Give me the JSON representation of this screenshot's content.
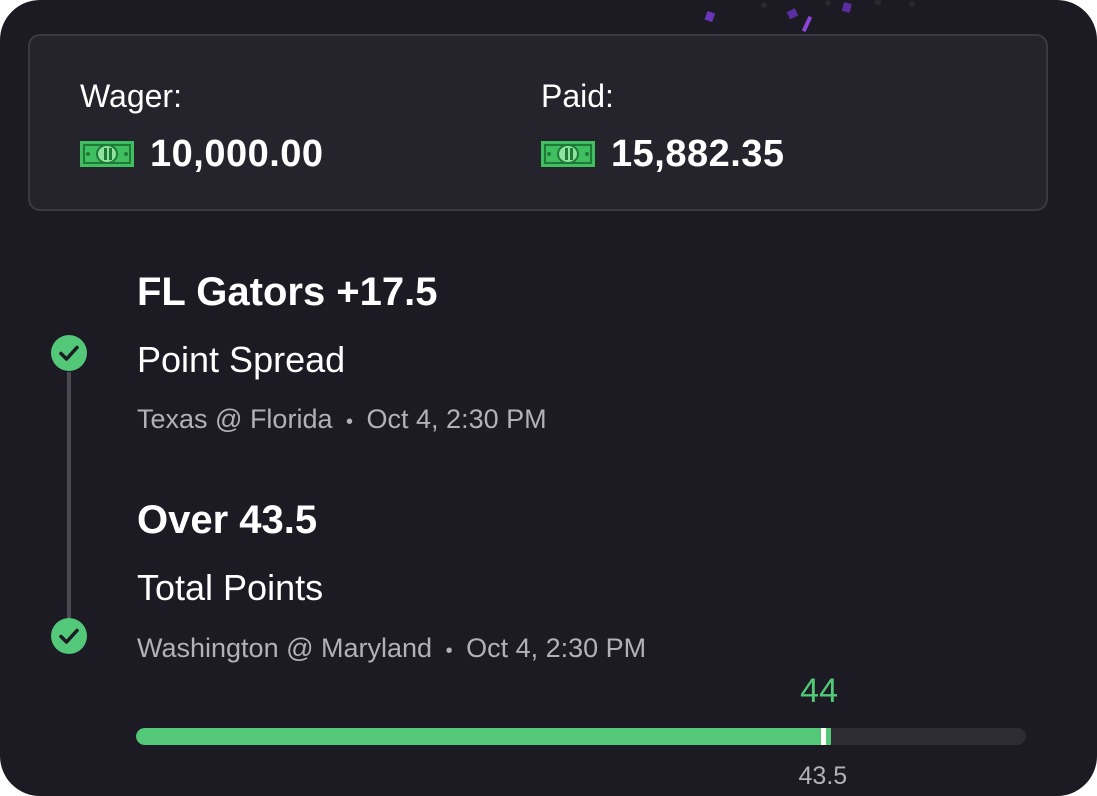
{
  "colors": {
    "background": "#1c1a22",
    "panel": "#25232b",
    "success_green": "#52c878",
    "muted_text": "#b3b1b8",
    "confetti": "#7a3cc4"
  },
  "summary": {
    "wager_label": "Wager:",
    "wager_amount": "10,000.00",
    "paid_label": "Paid:",
    "paid_amount": "15,882.35",
    "currency_icon": "money-bill-icon"
  },
  "legs": [
    {
      "title": "FL Gators +17.5",
      "market": "Point Spread",
      "matchup": "Texas @ Florida",
      "separator": "•",
      "time": "Oct 4, 2:30 PM",
      "status_icon": "check-circle-icon"
    },
    {
      "title": "Over 43.5",
      "market": "Total Points",
      "matchup": "Washington @ Maryland",
      "separator": "•",
      "time": "Oct 4, 2:30 PM",
      "status_icon": "check-circle-icon"
    }
  ],
  "progress": {
    "actual_label": "44",
    "line_label": "43.5",
    "actual_fraction": 0.781,
    "line_fraction": 0.765
  }
}
